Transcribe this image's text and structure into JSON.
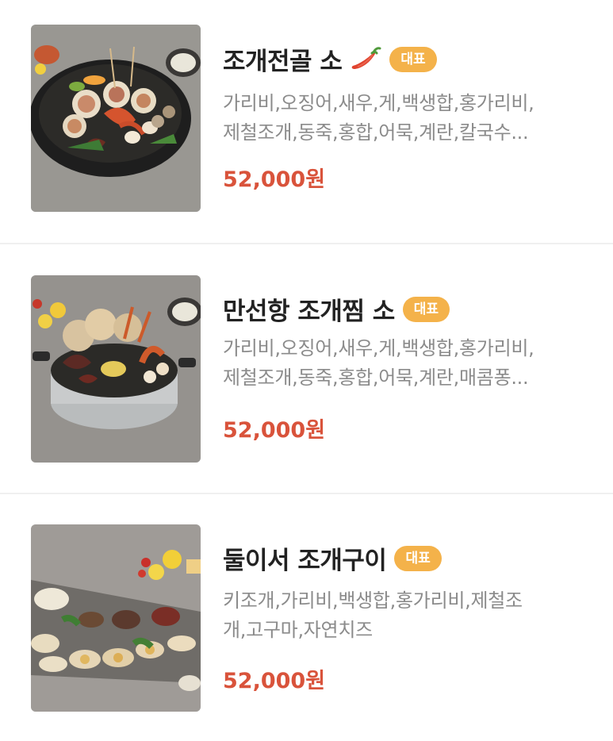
{
  "menu": {
    "items": [
      {
        "title": "조개전골 소",
        "spicy": true,
        "spicy_icon": "chili-pepper-icon",
        "badge": "대표",
        "description_lines": [
          "가리비,오징어,새우,게,백생합,홍가리비,",
          "제철조개,동죽,홍합,어묵,계란,칼국수..."
        ],
        "price": "52,000원"
      },
      {
        "title": "만선항 조개찜 소",
        "spicy": false,
        "badge": "대표",
        "description_lines": [
          "가리비,오징어,새우,게,백생합,홍가리비,",
          "제철조개,동죽,홍합,어묵,계란,매콤퐁..."
        ],
        "price": "52,000원"
      },
      {
        "title": "둘이서 조개구이",
        "spicy": false,
        "badge": "대표",
        "description_lines": [
          "키조개,가리비,백생합,홍가리비,제철조",
          "개,고구마,자연치즈"
        ],
        "price": "52,000원"
      }
    ]
  },
  "colors": {
    "badge_bg": "#f4b24a",
    "price": "#d9533b",
    "title": "#222222",
    "description": "#8b8b8b",
    "divider": "#f0f0f0"
  }
}
